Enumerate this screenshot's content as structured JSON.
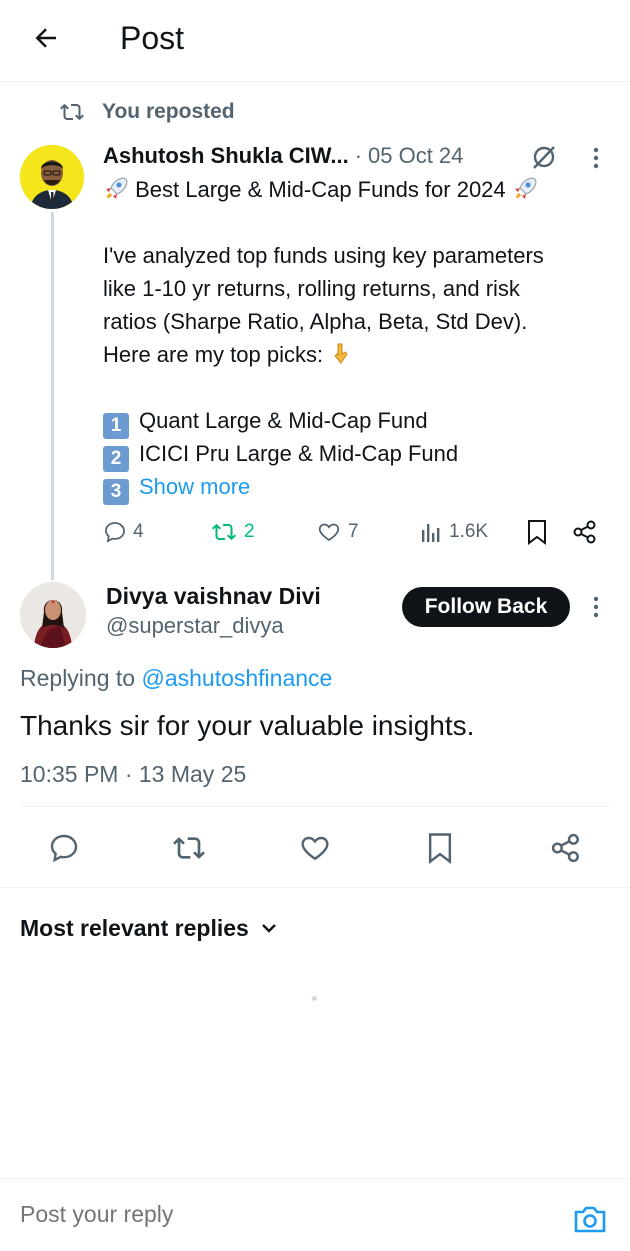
{
  "header": {
    "title": "Post"
  },
  "repost_banner": {
    "text": "You reposted"
  },
  "quoted_post": {
    "author_name": "Ashutosh Shukla CIW...",
    "separator": "·",
    "date": "05 Oct 24",
    "title_line": "Best Large & Mid-Cap Funds for 2024",
    "body_lines": [
      "I've analyzed top funds using key parameters",
      "like 1-10 yr returns, rolling returns, and risk",
      "ratios (Sharpe Ratio, Alpha, Beta, Std Dev).",
      "Here are my top picks:"
    ],
    "list": [
      {
        "num": "1",
        "text": "Quant Large & Mid-Cap Fund"
      },
      {
        "num": "2",
        "text": "ICICI Pru Large & Mid-Cap Fund"
      }
    ],
    "list_third_num": "3",
    "show_more": "Show more",
    "stats": {
      "replies": "4",
      "reposts": "2",
      "likes": "7",
      "views": "1.6K"
    }
  },
  "reply_post": {
    "author_name": "Divya vaishnav Divi",
    "handle": "@superstar_divya",
    "follow_label": "Follow Back",
    "replying_prefix": "Replying to",
    "replying_handle": "@ashutoshfinance",
    "text": "Thanks sir for your valuable insights.",
    "timestamp": "10:35 PM · 13 May 25"
  },
  "sort": {
    "label": "Most relevant replies"
  },
  "composer": {
    "placeholder": "Post your reply"
  },
  "colors": {
    "accent": "#1d9bf0",
    "repost_green": "#00ba7c",
    "muted": "#536471"
  }
}
